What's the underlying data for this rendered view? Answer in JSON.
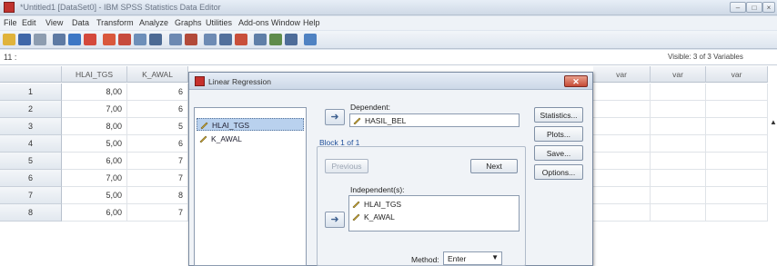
{
  "window": {
    "title": "*Untitled1 [DataSet0] - IBM SPSS Statistics Data Editor",
    "controls": [
      "–",
      "□",
      "×"
    ]
  },
  "menubar": [
    "File",
    "Edit",
    "View",
    "Data",
    "Transform",
    "Analyze",
    "Graphs",
    "Utilities",
    "Add-ons",
    "Window",
    "Help"
  ],
  "toolbar": {
    "icons": [
      "open-icon",
      "save-icon",
      "print-icon",
      "dialog-recall-icon",
      "undo-icon",
      "redo-icon",
      "goto-case-icon",
      "goto-variable-icon",
      "variables-icon",
      "find-icon",
      "insert-cases-icon",
      "insert-variable-icon",
      "split-file-icon",
      "weight-cases-icon",
      "select-cases-icon",
      "value-labels-icon",
      "use-sets-icon",
      "spell-icon",
      "chart-icon"
    ]
  },
  "cellbar": {
    "reference": "11 :",
    "visible": "Visible: 3 of 3 Variables"
  },
  "grid": {
    "columns": [
      "",
      "HLAI_TGS",
      "K_AWAL",
      "var",
      "var",
      "var"
    ],
    "rows": [
      {
        "n": "1",
        "hlai": "8,00",
        "kawal": "6"
      },
      {
        "n": "2",
        "hlai": "7,00",
        "kawal": "6"
      },
      {
        "n": "3",
        "hlai": "8,00",
        "kawal": "5"
      },
      {
        "n": "4",
        "hlai": "5,00",
        "kawal": "6"
      },
      {
        "n": "5",
        "hlai": "6,00",
        "kawal": "7"
      },
      {
        "n": "6",
        "hlai": "7,00",
        "kawal": "7"
      },
      {
        "n": "7",
        "hlai": "5,00",
        "kawal": "8"
      },
      {
        "n": "8",
        "hlai": "6,00",
        "kawal": "7"
      }
    ]
  },
  "dialog": {
    "title": "Linear Regression",
    "variables": [
      "HLAI_TGS",
      "K_AWAL"
    ],
    "dependent_label": "Dependent:",
    "dependent_value": "HASIL_BEL",
    "block_label": "Block 1 of 1",
    "previous_label": "Previous",
    "next_label": "Next",
    "independent_label": "Independent(s):",
    "independents": [
      "HLAI_TGS",
      "K_AWAL"
    ],
    "method_label": "Method:",
    "method_value": "Enter",
    "buttons": [
      "Statistics...",
      "Plots...",
      "Save...",
      "Options..."
    ]
  }
}
